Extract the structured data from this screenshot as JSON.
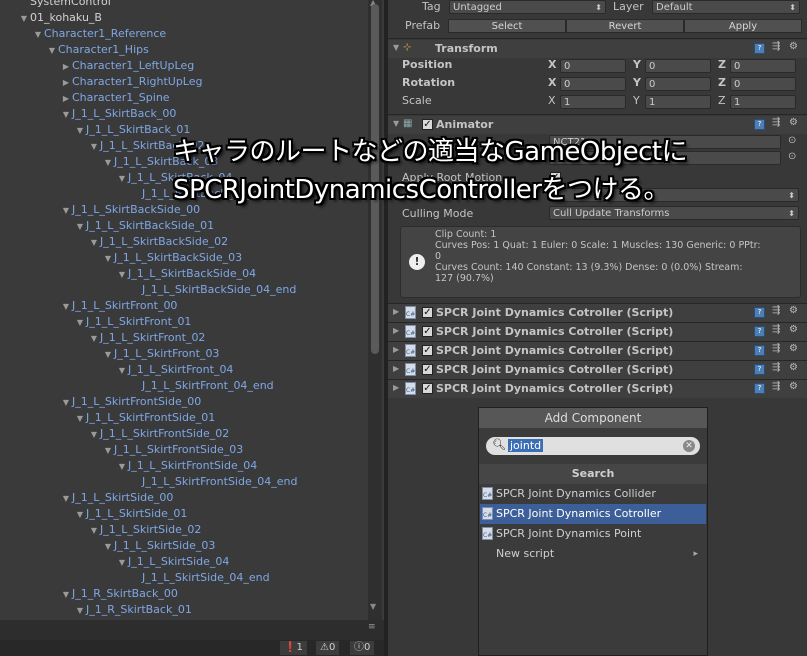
{
  "hierarchy": {
    "rows": [
      {
        "label": "SystemControl",
        "depth": 0,
        "arrow": "",
        "style": "top"
      },
      {
        "label": "01_kohaku_B",
        "depth": 0,
        "arrow": "▼",
        "style": "top"
      },
      {
        "label": "Character1_Reference",
        "depth": 1,
        "arrow": "▼",
        "style": ""
      },
      {
        "label": "Character1_Hips",
        "depth": 2,
        "arrow": "▼",
        "style": ""
      },
      {
        "label": "Character1_LeftUpLeg",
        "depth": 3,
        "arrow": "▶",
        "style": ""
      },
      {
        "label": "Character1_RightUpLeg",
        "depth": 3,
        "arrow": "▶",
        "style": ""
      },
      {
        "label": "Character1_Spine",
        "depth": 3,
        "arrow": "▶",
        "style": ""
      },
      {
        "label": "J_1_L_SkirtBack_00",
        "depth": 3,
        "arrow": "▼",
        "style": ""
      },
      {
        "label": "J_1_L_SkirtBack_01",
        "depth": 4,
        "arrow": "▼",
        "style": ""
      },
      {
        "label": "J_1_L_SkirtBack_02",
        "depth": 5,
        "arrow": "▼",
        "style": ""
      },
      {
        "label": "J_1_L_SkirtBack_03",
        "depth": 6,
        "arrow": "▼",
        "style": ""
      },
      {
        "label": "J_1_L_SkirtBack_04",
        "depth": 7,
        "arrow": "▼",
        "style": ""
      },
      {
        "label": "J_1_L_SkirtBack_04_end",
        "depth": 8,
        "arrow": "",
        "style": ""
      },
      {
        "label": "J_1_L_SkirtBackSide_00",
        "depth": 3,
        "arrow": "▼",
        "style": ""
      },
      {
        "label": "J_1_L_SkirtBackSide_01",
        "depth": 4,
        "arrow": "▼",
        "style": ""
      },
      {
        "label": "J_1_L_SkirtBackSide_02",
        "depth": 5,
        "arrow": "▼",
        "style": ""
      },
      {
        "label": "J_1_L_SkirtBackSide_03",
        "depth": 6,
        "arrow": "▼",
        "style": ""
      },
      {
        "label": "J_1_L_SkirtBackSide_04",
        "depth": 7,
        "arrow": "▼",
        "style": ""
      },
      {
        "label": "J_1_L_SkirtBackSide_04_end",
        "depth": 8,
        "arrow": "",
        "style": ""
      },
      {
        "label": "J_1_L_SkirtFront_00",
        "depth": 3,
        "arrow": "▼",
        "style": ""
      },
      {
        "label": "J_1_L_SkirtFront_01",
        "depth": 4,
        "arrow": "▼",
        "style": ""
      },
      {
        "label": "J_1_L_SkirtFront_02",
        "depth": 5,
        "arrow": "▼",
        "style": ""
      },
      {
        "label": "J_1_L_SkirtFront_03",
        "depth": 6,
        "arrow": "▼",
        "style": ""
      },
      {
        "label": "J_1_L_SkirtFront_04",
        "depth": 7,
        "arrow": "▼",
        "style": ""
      },
      {
        "label": "J_1_L_SkirtFront_04_end",
        "depth": 8,
        "arrow": "",
        "style": ""
      },
      {
        "label": "J_1_L_SkirtFrontSide_00",
        "depth": 3,
        "arrow": "▼",
        "style": ""
      },
      {
        "label": "J_1_L_SkirtFrontSide_01",
        "depth": 4,
        "arrow": "▼",
        "style": ""
      },
      {
        "label": "J_1_L_SkirtFrontSide_02",
        "depth": 5,
        "arrow": "▼",
        "style": ""
      },
      {
        "label": "J_1_L_SkirtFrontSide_03",
        "depth": 6,
        "arrow": "▼",
        "style": ""
      },
      {
        "label": "J_1_L_SkirtFrontSide_04",
        "depth": 7,
        "arrow": "▼",
        "style": ""
      },
      {
        "label": "J_1_L_SkirtFrontSide_04_end",
        "depth": 8,
        "arrow": "",
        "style": ""
      },
      {
        "label": "J_1_L_SkirtSide_00",
        "depth": 3,
        "arrow": "▼",
        "style": ""
      },
      {
        "label": "J_1_L_SkirtSide_01",
        "depth": 4,
        "arrow": "▼",
        "style": ""
      },
      {
        "label": "J_1_L_SkirtSide_02",
        "depth": 5,
        "arrow": "▼",
        "style": ""
      },
      {
        "label": "J_1_L_SkirtSide_03",
        "depth": 6,
        "arrow": "▼",
        "style": ""
      },
      {
        "label": "J_1_L_SkirtSide_04",
        "depth": 7,
        "arrow": "▼",
        "style": ""
      },
      {
        "label": "J_1_L_SkirtSide_04_end",
        "depth": 8,
        "arrow": "",
        "style": ""
      },
      {
        "label": "J_1_R_SkirtBack_00",
        "depth": 3,
        "arrow": "▼",
        "style": ""
      },
      {
        "label": "J_1_R_SkirtBack_01",
        "depth": 4,
        "arrow": "▼",
        "style": ""
      }
    ],
    "status": {
      "errors": "1",
      "warnings": "0",
      "messages": "0"
    }
  },
  "inspector": {
    "tag_label": "Tag",
    "tag_value": "Untagged",
    "layer_label": "Layer",
    "layer_value": "Default",
    "prefab_label": "Prefab",
    "prefab_select": "Select",
    "prefab_revert": "Revert",
    "prefab_apply": "Apply",
    "transform": {
      "title": "Transform",
      "rows": [
        {
          "label": "Position",
          "x": "0",
          "y": "0",
          "z": "0",
          "bold": true
        },
        {
          "label": "Rotation",
          "x": "0",
          "y": "0",
          "z": "0",
          "bold": true
        },
        {
          "label": "Scale",
          "x": "1",
          "y": "1",
          "z": "1",
          "bold": false
        }
      ]
    },
    "animator": {
      "title": "Animator",
      "controller_value_partial": "NCT21",
      "apply_root_motion": "Apply Root Motion",
      "culling_label": "Culling Mode",
      "culling_value": "Cull Update Transforms",
      "info": [
        "Clip Count: 1",
        "Curves Pos: 1 Quat: 1 Euler: 0 Scale: 1 Muscles: 130 Generic: 0 PPtr:",
        "0",
        "Curves Count: 140 Constant: 13 (9.3%) Dense: 0 (0.0%) Stream:",
        "127 (90.7%)"
      ]
    },
    "scripts": [
      "SPCR Joint Dynamics Cotroller (Script)",
      "SPCR Joint Dynamics Cotroller (Script)",
      "SPCR Joint Dynamics Cotroller (Script)",
      "SPCR Joint Dynamics Cotroller (Script)",
      "SPCR Joint Dynamics Cotroller (Script)"
    ]
  },
  "add_component": {
    "title": "Add Component",
    "search_value": "jointd",
    "section": "Search",
    "items": [
      {
        "label": "SPCR Joint Dynamics Collider",
        "selected": false,
        "icon": true
      },
      {
        "label": "SPCR Joint Dynamics Cotroller",
        "selected": true,
        "icon": true
      },
      {
        "label": "SPCR Joint Dynamics Point",
        "selected": false,
        "icon": true
      },
      {
        "label": "New script",
        "selected": false,
        "icon": false,
        "submenu": "▸"
      }
    ]
  },
  "caption": {
    "line1": "キャラのルートなどの適当なGameObjectに",
    "line2": "SPCRJointDynamicsControllerをつける。"
  }
}
